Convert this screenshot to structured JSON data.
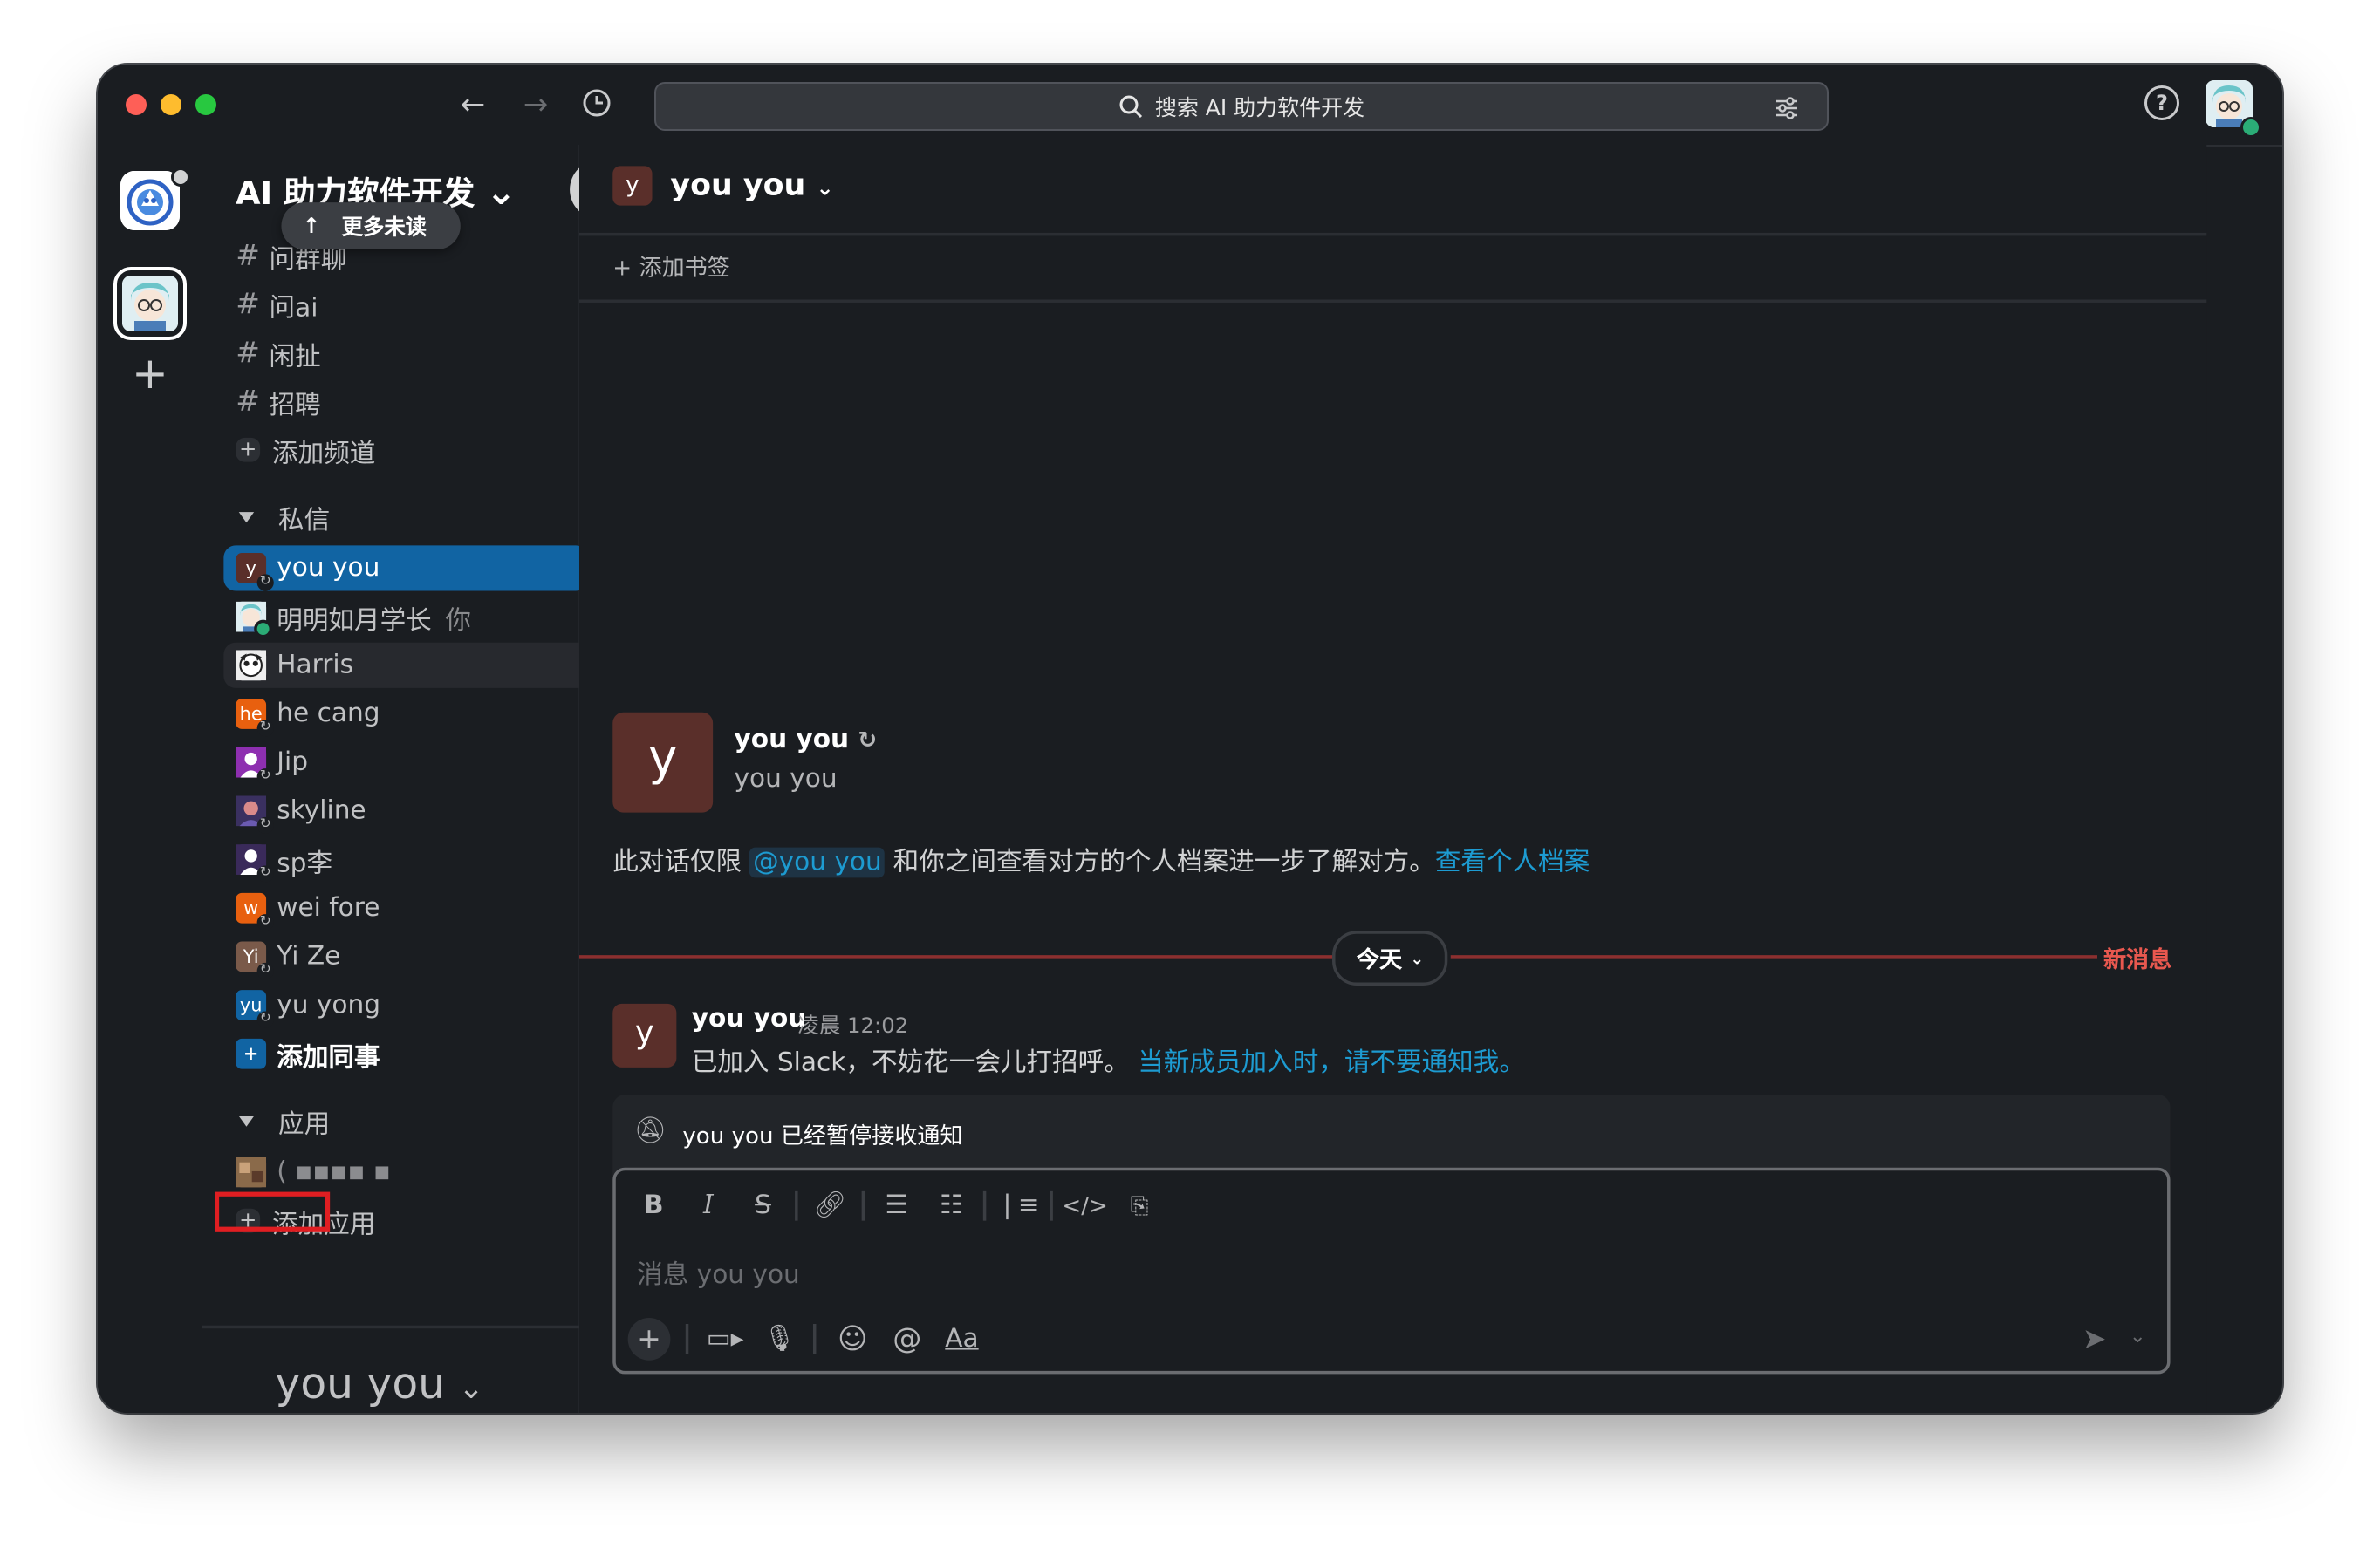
{
  "search": {
    "label": "搜索 AI 助力软件开发"
  },
  "workspace": {
    "name": "AI 助力软件开发"
  },
  "sidebar": {
    "more_unread": "更多未读",
    "channels": [
      {
        "label": "问群聊"
      },
      {
        "label": "问ai"
      },
      {
        "label": "闲扯"
      },
      {
        "label": "招聘"
      }
    ],
    "add_channel": "添加频道",
    "dm_section": "私信",
    "dms": [
      {
        "label": "you you",
        "initial": "y",
        "color": "#5a2f2a"
      },
      {
        "label": "明明如月学长",
        "suffix": "你"
      },
      {
        "label": "Harris"
      },
      {
        "label": "he cang",
        "initial": "he",
        "color": "#e8600f"
      },
      {
        "label": "Jip"
      },
      {
        "label": "skyline"
      },
      {
        "label": "sp李"
      },
      {
        "label": "wei fore",
        "initial": "w",
        "color": "#e8600f"
      },
      {
        "label": "Yi Ze",
        "initial": "Yi",
        "color": "#7a5a4a"
      },
      {
        "label": "yu yong",
        "initial": "yu",
        "color": "#1164a3"
      }
    ],
    "add_colleague": "添加同事",
    "apps_section": "应用",
    "app_item": "( ▪▪▪▪ ▪",
    "add_app": "添加应用",
    "footer_name": "you you"
  },
  "channel": {
    "name": "you you",
    "avatar_initial": "y",
    "add_bookmark": "添加书签"
  },
  "intro": {
    "name": "you you",
    "subtitle": "you you",
    "text_before": "此对话仅限 ",
    "mention": "@you you",
    "text_after": " 和你之间查看对方的个人档案进一步了解对方。",
    "link": "查看个人档案"
  },
  "divider": {
    "today": "今天",
    "new_messages": "新消息"
  },
  "message": {
    "author": "you you",
    "time": "凌晨 12:02",
    "text": "已加入 Slack，不妨花一会儿打招呼。",
    "link": "当新成员加入时，请不要通知我。"
  },
  "notice": {
    "text": "you you 已经暂停接收通知"
  },
  "composer": {
    "placeholder": "消息 you you",
    "aa_label": "Aa"
  },
  "colors": {
    "accent": "#1164a3",
    "link": "#1d9bd1",
    "new_message": "#e8584f",
    "highlight_box": "#e01e22"
  }
}
